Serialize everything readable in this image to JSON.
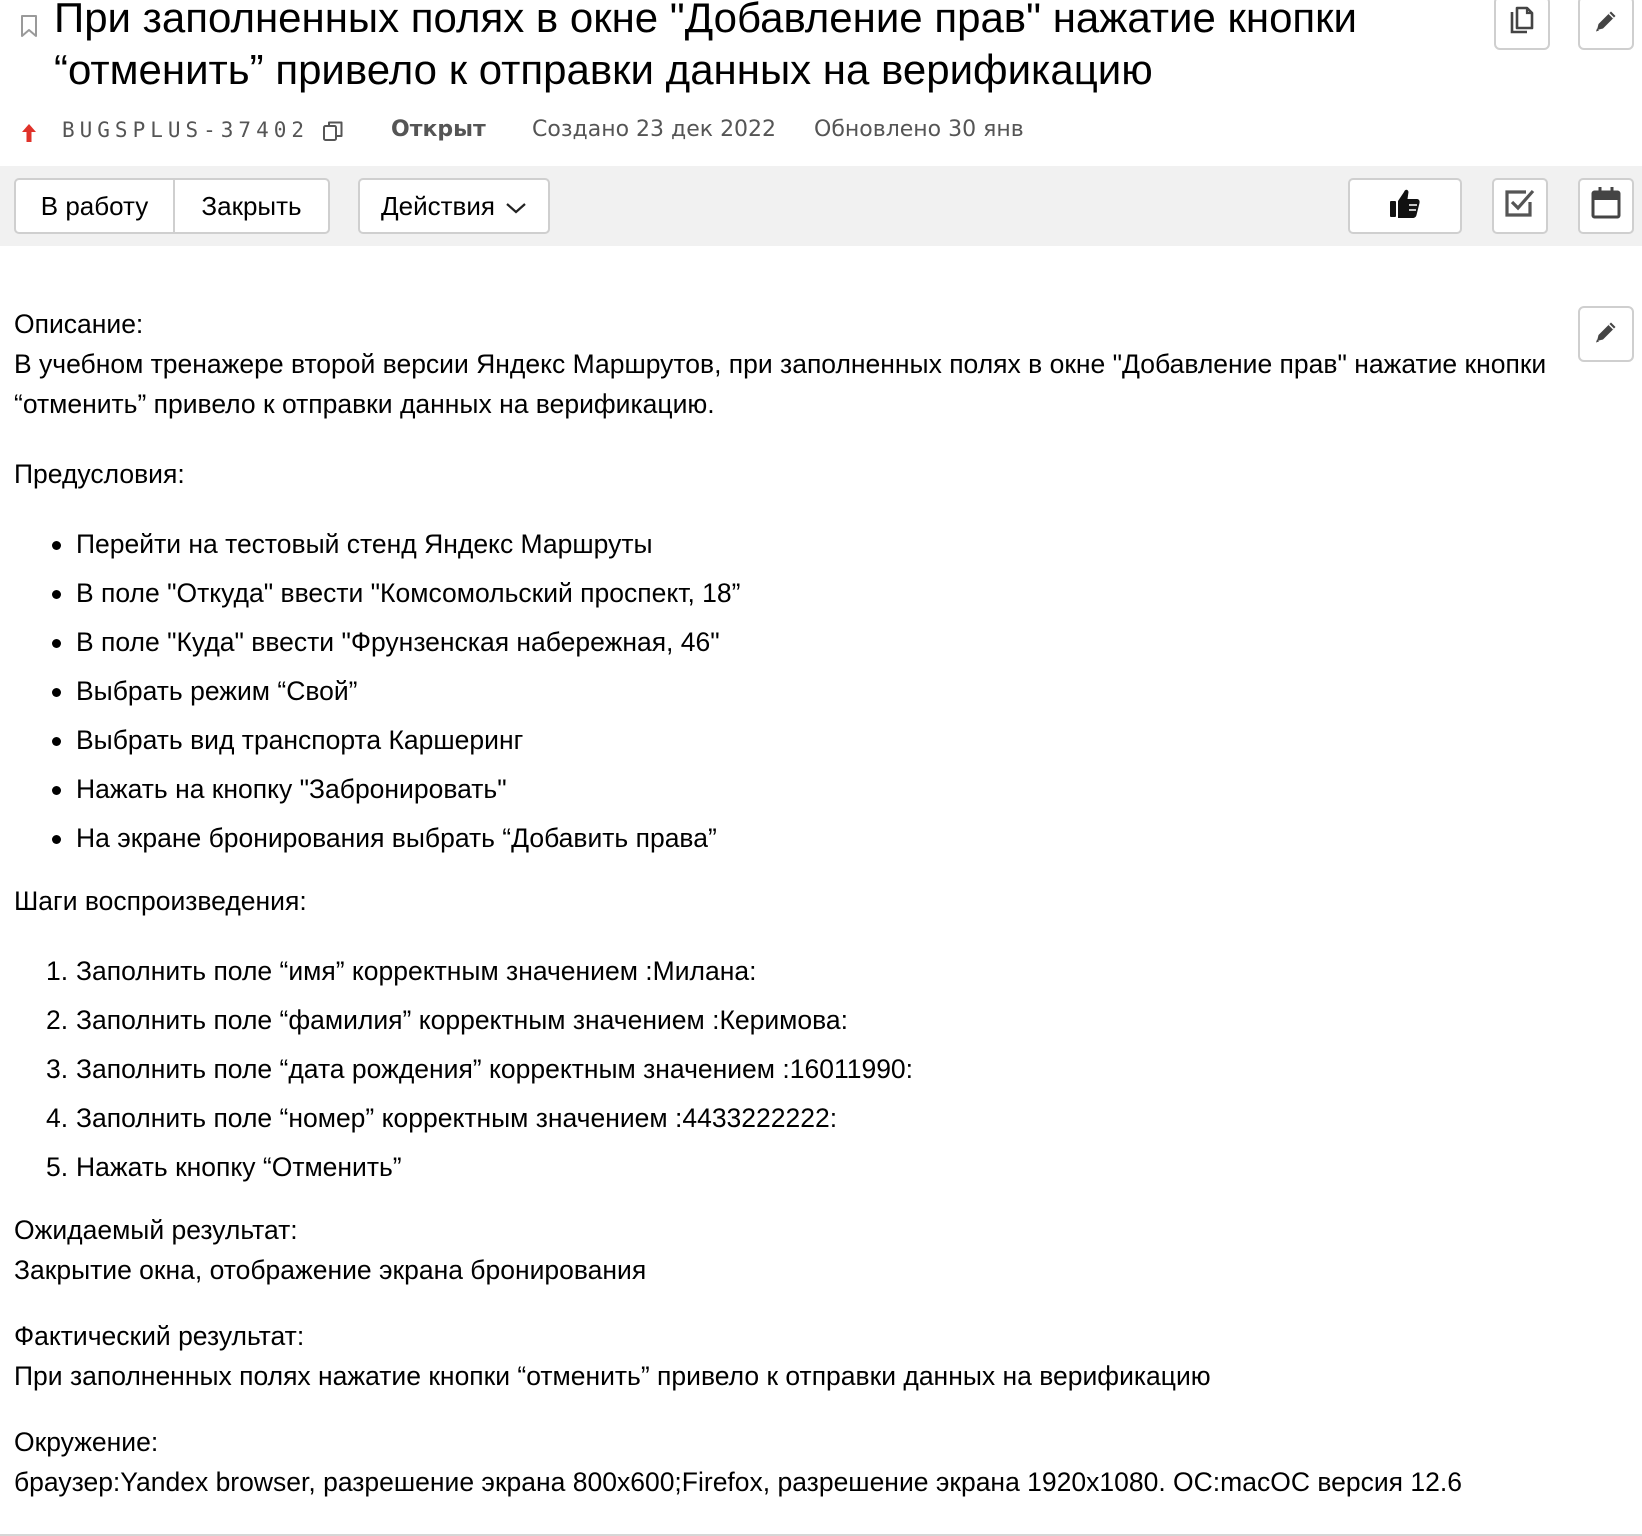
{
  "header": {
    "title": "При заполненных полях в окне \"Добавление прав\" нажатие кнопки\n“отменить” привело к отправки данных на верификацию",
    "icons": [
      "bookmark-icon",
      "copy-icon",
      "pencil-icon"
    ]
  },
  "meta": {
    "issue_key": "BUGSPLUS-37402",
    "status": "Открыт",
    "created": "Создано 23 дек 2022",
    "updated": "Обновлено 30 янв",
    "priority_color": "#e0322a",
    "icons": [
      "arrow-up-icon",
      "copy-key-icon"
    ]
  },
  "toolbar": {
    "work_label": "В работу",
    "close_label": "Закрыть",
    "actions_label": "Действия",
    "icons": [
      "thumbs-up-icon",
      "checkbox-icon",
      "calendar-icon"
    ]
  },
  "description": {
    "heading": "Описание:",
    "text": "В учебном тренажере второй версии Яндекс Маршрутов, при заполненных полях в окне \"Добавление прав\" нажатие кнопки “отменить” привело к отправки данных на верификацию.",
    "preconditions_heading": "Предусловия:",
    "preconditions": [
      "Перейти на тестовый стенд Яндекс Маршруты",
      "В поле \"Откуда\" ввести \"Комсомольский проспект, 18”",
      "В поле \"Куда\" ввести \"Фрунзенская набережная, 46\"",
      "Выбрать режим “Свой”",
      "Выбрать вид транспорта Каршеринг",
      "Нажать на кнопку \"Забронировать\"",
      "На экране бронирования выбрать “Добавить права”"
    ],
    "steps_heading": "Шаги воспроизведения:",
    "steps": [
      {
        "num": "1.",
        "text": "Заполнить поле “имя” корректным значением :Милана:"
      },
      {
        "num": "2.",
        "text": "Заполнить поле “фамилия” корректным значением :Керимова:"
      },
      {
        "num": "3.",
        "text": "Заполнить поле “дата рождения” корректным значением :16011990:"
      },
      {
        "num": "4.",
        "text": "Заполнить поле “номер” корректным значением :4433222222:"
      },
      {
        "num": "5.",
        "text": "Нажать кнопку “Отменить”"
      }
    ],
    "expected_heading": "Ожидаемый результат:",
    "expected": "Закрытие окна, отображение экрана бронирования",
    "actual_heading": "Фактический результат:",
    "actual": "При заполненных полях нажатие кнопки “отменить” привело к отправки данных на верификацию",
    "environment_heading": "Окружение:",
    "environment": "браузер:Yandex browser, разрешение экрана 800x600;Firefox, разрешение экрана 1920x1080. ОС:macOC версия 12.6"
  }
}
